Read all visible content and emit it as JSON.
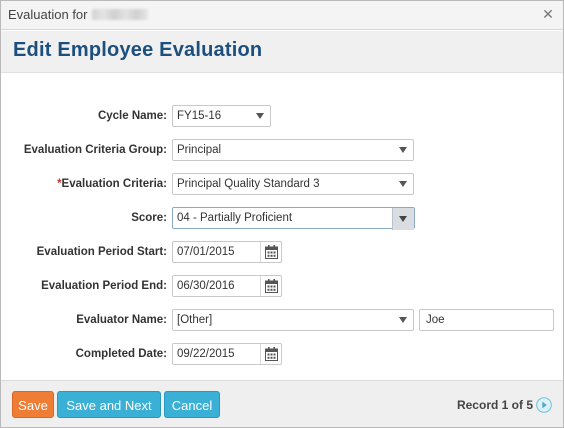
{
  "window": {
    "title": "Evaluation for"
  },
  "page": {
    "title": "Edit Employee Evaluation"
  },
  "form": {
    "cycle_name": {
      "label": "Cycle Name:",
      "value": "FY15-16"
    },
    "criteria_group": {
      "label": "Evaluation Criteria Group:",
      "value": "Principal"
    },
    "criteria": {
      "required_mark": "*",
      "label": "Evaluation Criteria:",
      "value": "Principal Quality Standard 3"
    },
    "score": {
      "label": "Score:",
      "value": "04 - Partially Proficient"
    },
    "period_start": {
      "label": "Evaluation Period Start:",
      "value": "07/01/2015"
    },
    "period_end": {
      "label": "Evaluation Period End:",
      "value": "06/30/2016"
    },
    "evaluator": {
      "label": "Evaluator Name:",
      "value": "[Other]",
      "other_name": "Joe"
    },
    "completed": {
      "label": "Completed Date:",
      "value": "09/22/2015"
    }
  },
  "footer": {
    "save_label": "Save",
    "save_next_label": "Save and Next",
    "cancel_label": "Cancel",
    "record_text": "Record 1 of 5"
  },
  "icons": {
    "close": "close-icon",
    "calendar": "calendar-icon",
    "dropdown": "chevron-down-icon",
    "next": "next-record-icon"
  },
  "colors": {
    "title_blue": "#1c4f7e",
    "save_orange": "#f07d35",
    "action_blue": "#3bb0d6",
    "required_red": "#c0392b"
  }
}
